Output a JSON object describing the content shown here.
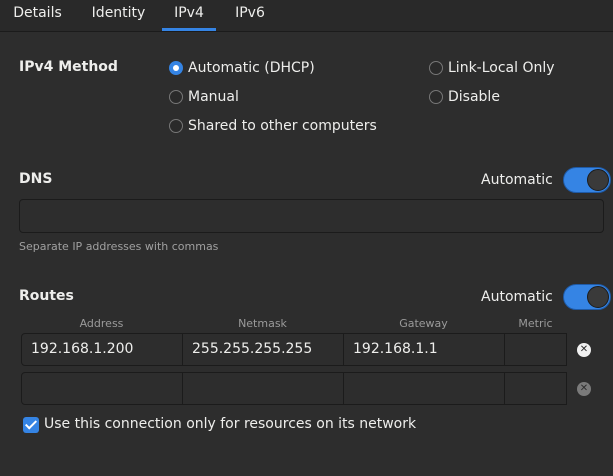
{
  "tabs": [
    {
      "label": "Details"
    },
    {
      "label": "Identity"
    },
    {
      "label": "IPv4",
      "active": true
    },
    {
      "label": "IPv6"
    }
  ],
  "ipv4_method": {
    "label": "IPv4 Method",
    "options": [
      {
        "label": "Automatic (DHCP)",
        "checked": true
      },
      {
        "label": "Manual",
        "checked": false
      },
      {
        "label": "Shared to other computers",
        "checked": false
      },
      {
        "label": "Link-Local Only",
        "checked": false
      },
      {
        "label": "Disable",
        "checked": false
      }
    ]
  },
  "dns": {
    "label": "DNS",
    "automatic_label": "Automatic",
    "automatic_on": true,
    "value": "",
    "hint": "Separate IP addresses with commas"
  },
  "routes": {
    "label": "Routes",
    "automatic_label": "Automatic",
    "automatic_on": true,
    "columns": [
      "Address",
      "Netmask",
      "Gateway",
      "Metric"
    ],
    "rows": [
      {
        "address": "192.168.1.200",
        "netmask": "255.255.255.255",
        "gateway": "192.168.1.1",
        "metric": ""
      },
      {
        "address": "",
        "netmask": "",
        "gateway": "",
        "metric": ""
      }
    ]
  },
  "only_local": {
    "label": "Use this connection only for resources on its network",
    "checked": true
  },
  "colors": {
    "accent": "#3584e4",
    "background": "#2d2d2d"
  }
}
